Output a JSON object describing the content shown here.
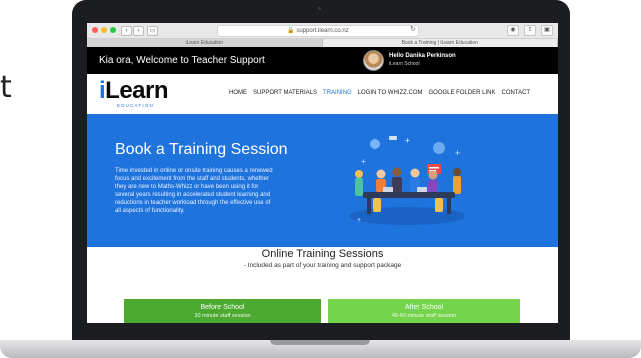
{
  "side_text": "t",
  "browser": {
    "url": "support.ilearn.co.nz",
    "tabs": [
      {
        "label": "iLearn Education",
        "active": false
      },
      {
        "label": "Book a Training | iLearn Education",
        "active": true
      }
    ]
  },
  "site": {
    "welcome": "Kia ora, Welcome to Teacher Support",
    "user": {
      "hello": "Hello Danika Perkinson",
      "school": "iLearn School"
    },
    "logo": {
      "prefix": "i",
      "main": "Learn",
      "sub": "EDUCATION"
    },
    "nav": [
      "HOME",
      "SUPPORT MATERIALS",
      "TRAINING",
      "LOGIN TO WHIZZ.COM",
      "GOOGLE FOLDER LINK",
      "CONTACT"
    ],
    "nav_active": "TRAINING",
    "hero": {
      "title": "Book a Training Session",
      "text": "Time invested in online or onsite training causes a renewed focus and excitement from the staff and students, whether they are new to Maths-Whizz or have been using it for several years resulting in accelerated student learning and reductions in teacher workload through the effective use of all aspects of functionality."
    },
    "training": {
      "title": "Online Training Sessions",
      "subtitle": "- Included as part of your training and support package",
      "cards": [
        {
          "title": "Before School",
          "subtitle": "30 minute staff session"
        },
        {
          "title": "After School",
          "subtitle": "45-60 minute staff session"
        }
      ]
    }
  },
  "colors": {
    "brand_blue": "#1f73dd",
    "green_dark": "#4caa31",
    "green_light": "#74d44c"
  }
}
